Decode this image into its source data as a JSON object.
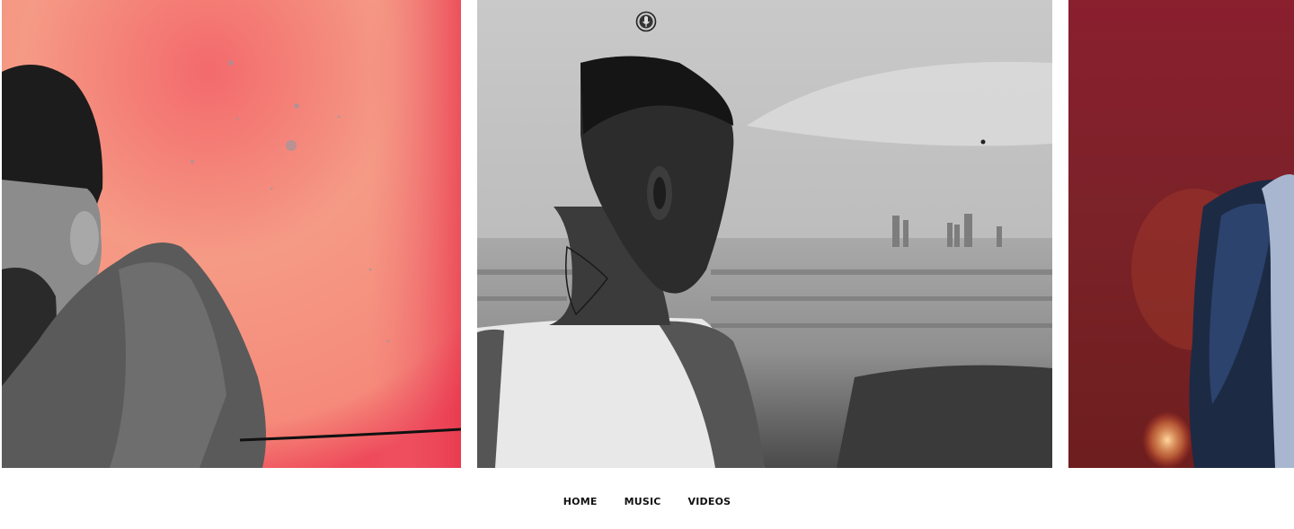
{
  "brand": {
    "logo_icon": "microphone-seal-icon"
  },
  "carousel": {
    "slides": [
      {
        "name": "artist-portrait-red",
        "background": "#f48a7a"
      },
      {
        "name": "artist-portrait-city-bw",
        "background": "#bfbfbf"
      },
      {
        "name": "artist-performance-red",
        "background": "#7a1f24"
      }
    ]
  },
  "nav": {
    "items": [
      {
        "label": "HOME"
      },
      {
        "label": "MUSIC"
      },
      {
        "label": "VIDEOS"
      }
    ]
  }
}
